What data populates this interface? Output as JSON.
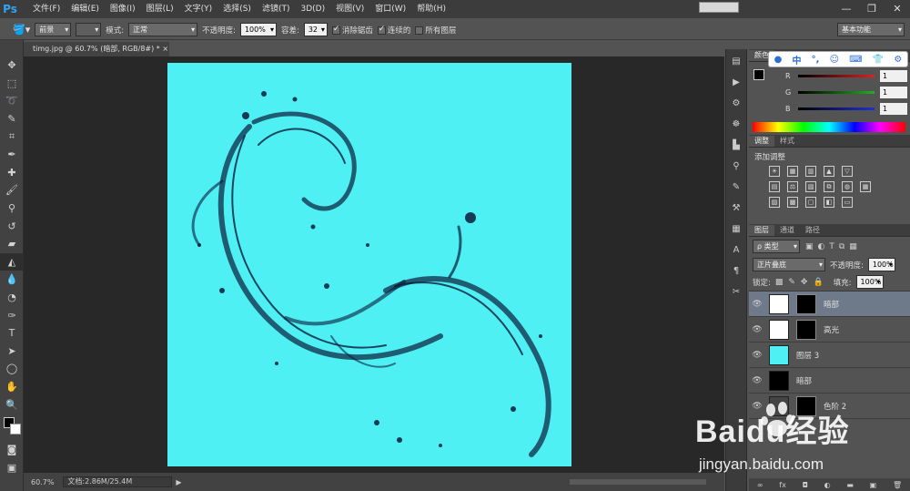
{
  "app": {
    "logo": "Ps"
  },
  "menu": [
    "文件(F)",
    "编辑(E)",
    "图像(I)",
    "图层(L)",
    "文字(Y)",
    "选择(S)",
    "滤镜(T)",
    "3D(D)",
    "视图(V)",
    "窗口(W)",
    "帮助(H)"
  ],
  "window_buttons": [
    "—",
    "❐",
    "✕"
  ],
  "options": {
    "fill_source": "前景",
    "mode_label": "模式:",
    "mode_value": "正常",
    "opacity_label": "不透明度:",
    "opacity_value": "100%",
    "tolerance_label": "容差:",
    "tolerance_value": "32",
    "antialias_label": "消除锯齿",
    "contiguous_label": "连续的",
    "all_layers_label": "所有图层",
    "workspace": "基本功能"
  },
  "document": {
    "tab_title": "timg.jpg @ 60.7% (暗部, RGB/8#) *"
  },
  "status": {
    "zoom": "60.7%",
    "doc_info": "文档:2.86M/25.4M"
  },
  "sogou_toolbar": [
    "●",
    "中",
    "°,",
    "☺",
    "⌨",
    "👕",
    "⚙"
  ],
  "color_panel": {
    "title": "颜色",
    "channels": [
      {
        "name": "R",
        "value": "1",
        "color": "#e02020"
      },
      {
        "name": "G",
        "value": "1",
        "color": "#20b020"
      },
      {
        "name": "B",
        "value": "1",
        "color": "#2030d0"
      }
    ]
  },
  "adjust_panel": {
    "tabs": [
      "调整",
      "样式"
    ],
    "heading": "添加调整",
    "rows": [
      [
        "☀",
        "▦",
        "▥",
        "▲",
        "▽"
      ],
      [
        "▤",
        "⚖",
        "▧",
        "⧉",
        "◍",
        "▦"
      ],
      [
        "▨",
        "▩",
        "▢",
        "◧",
        "▭"
      ]
    ]
  },
  "layers_panel": {
    "tabs": [
      "图层",
      "通道",
      "路径"
    ],
    "filter_label": "ρ 类型",
    "blend_mode": "正片叠底",
    "opacity_label": "不透明度:",
    "opacity_value": "100%",
    "lock_label": "锁定:",
    "fill_label": "填充:",
    "fill_value": "100%",
    "layers": [
      {
        "name": "暗部",
        "thumb": "#ffffff",
        "mask": true,
        "selected": true
      },
      {
        "name": "高光",
        "thumb": "#ffffff",
        "mask": true,
        "selected": false
      },
      {
        "name": "图层 3",
        "thumb": "#4ef0f4",
        "mask": false,
        "selected": false
      },
      {
        "name": "暗部",
        "thumb": "#000000",
        "mask": false,
        "selected": false
      },
      {
        "name": "色阶 2",
        "thumb": "#444444",
        "mask": true,
        "selected": false
      }
    ],
    "footer_icons": [
      "∞",
      "fx",
      "◘",
      "◐",
      "▬",
      "▣",
      "🗑"
    ]
  },
  "watermark": {
    "brand": "Baidu经验",
    "url": "jingyan.baidu.com"
  },
  "colors": {
    "canvas_bg": "#4ef0f4",
    "ui_dark": "#535353"
  }
}
